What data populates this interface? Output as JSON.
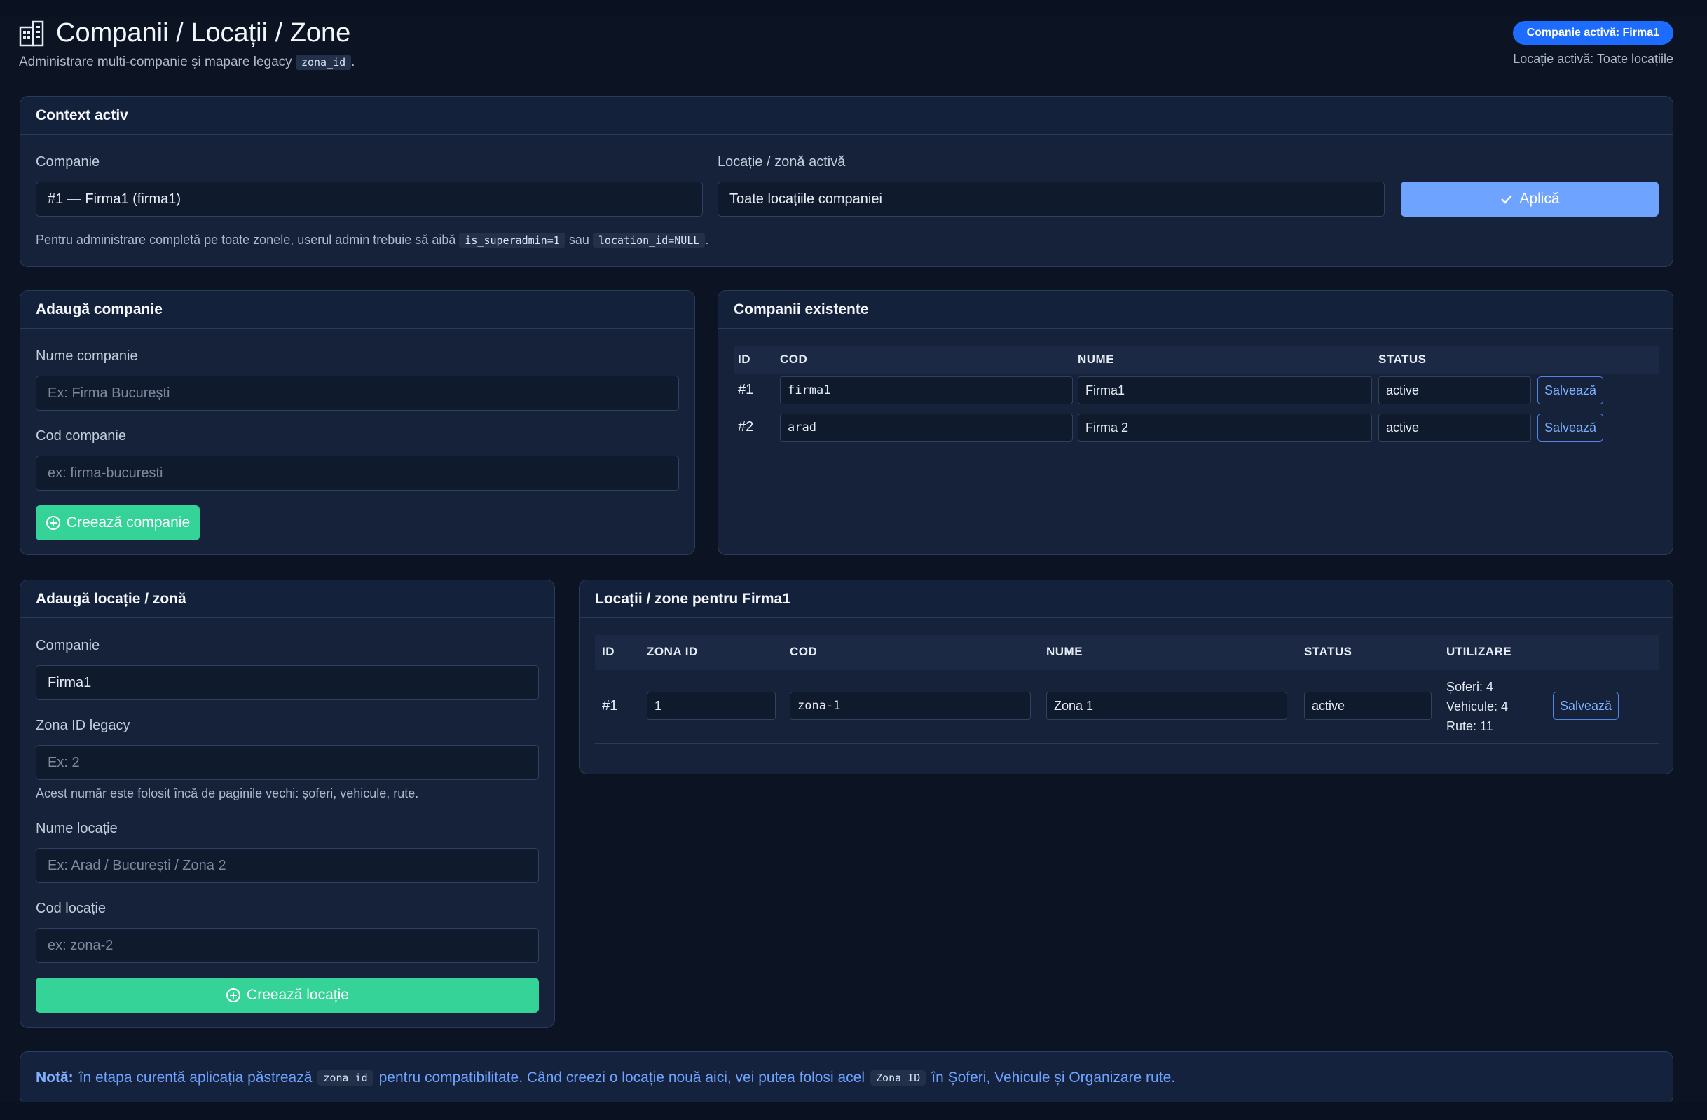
{
  "header": {
    "title": "Companii / Locații / Zone",
    "subtitle_prefix": "Administrare multi-companie și mapare legacy",
    "subtitle_code": "zona_id",
    "subtitle_suffix": ".",
    "active_company_badge": "Companie activă: Firma1",
    "active_location": "Locație activă: Toate locațiile"
  },
  "context": {
    "title": "Context activ",
    "company_label": "Companie",
    "company_value": "#1 — Firma1 (firma1)",
    "location_label": "Locație / zonă activă",
    "location_value": "Toate locațiile companiei",
    "apply_label": "Aplică",
    "hint_prefix": "Pentru administrare completă pe toate zonele, userul admin trebuie să aibă",
    "hint_code1": "is_superadmin=1",
    "hint_mid": "sau",
    "hint_code2": "location_id=NULL",
    "hint_suffix": "."
  },
  "add_company": {
    "title": "Adaugă companie",
    "name_label": "Nume companie",
    "name_placeholder": "Ex: Firma București",
    "code_label": "Cod companie",
    "code_placeholder": "ex: firma-bucuresti",
    "create_label": "Creează companie"
  },
  "companies": {
    "title": "Companii existente",
    "columns": [
      "ID",
      "COD",
      "NUME",
      "STATUS"
    ],
    "rows": [
      {
        "id": "#1",
        "cod": "firma1",
        "nume": "Firma1",
        "status": "active",
        "save": "Salvează"
      },
      {
        "id": "#2",
        "cod": "arad",
        "nume": "Firma 2",
        "status": "active",
        "save": "Salvează"
      }
    ]
  },
  "add_location": {
    "title": "Adaugă locație / zonă",
    "company_label": "Companie",
    "company_value": "Firma1",
    "zona_label": "Zona ID legacy",
    "zona_placeholder": "Ex: 2",
    "zona_hint": "Acest număr este folosit încă de paginile vechi: șoferi, vehicule, rute.",
    "name_label": "Nume locație",
    "name_placeholder": "Ex: Arad / București / Zona 2",
    "code_label": "Cod locație",
    "code_placeholder": "ex: zona-2",
    "create_label": "Creează locație"
  },
  "locations": {
    "title": "Locații / zone pentru Firma1",
    "columns": [
      "ID",
      "ZONA ID",
      "COD",
      "NUME",
      "STATUS",
      "UTILIZARE"
    ],
    "rows": [
      {
        "id": "#1",
        "zona_id": "1",
        "cod": "zona-1",
        "nume": "Zona 1",
        "status": "active",
        "usage": [
          "Șoferi: 4",
          "Vehicule: 4",
          "Rute: 11"
        ],
        "save": "Salvează"
      }
    ]
  },
  "note": {
    "bold": "Notă:",
    "text1": "în etapa curentă aplicația păstrează",
    "code1": "zona_id",
    "text2": "pentru compatibilitate. Când creezi o locație nouă aici, vei putea folosi acel",
    "code2": "Zona ID",
    "text3": "în Șoferi, Vehicule și Organizare rute."
  },
  "icons": {
    "title_icon": "building-icon",
    "apply_icon": "check-icon",
    "create_icon": "plus-circle-icon"
  },
  "colors": {
    "accent": "#1e6bff",
    "apply": "#6ea3ff",
    "create": "#36d399",
    "background": "#0c1424",
    "card": "#15223a"
  }
}
